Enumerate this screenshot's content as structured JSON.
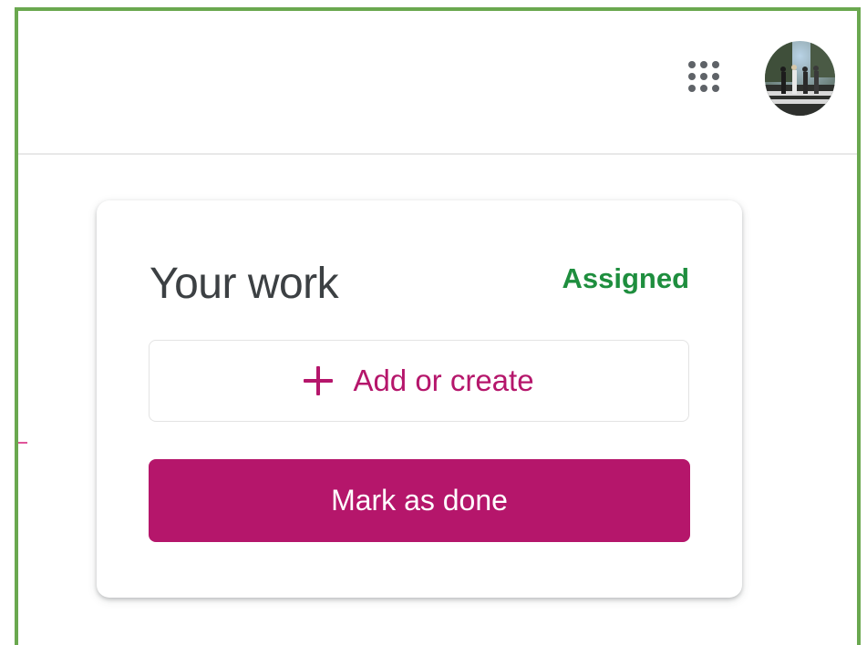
{
  "header": {
    "apps_icon": "apps-grid-icon",
    "avatar_icon": "user-avatar"
  },
  "your_work": {
    "title": "Your work",
    "status": "Assigned",
    "status_color": "#1e8e3e",
    "add_button": {
      "icon": "plus-icon",
      "label": "Add or create"
    },
    "mark_done_button": {
      "label": "Mark as done"
    },
    "accent_color": "#b5166b"
  }
}
